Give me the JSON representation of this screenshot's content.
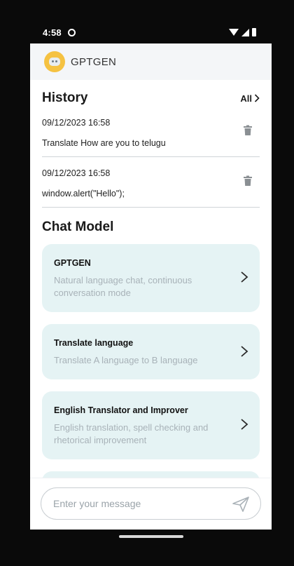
{
  "status_bar": {
    "time": "4:58"
  },
  "app_bar": {
    "title": "GPTGEN"
  },
  "history": {
    "title": "History",
    "all_label": "All",
    "items": [
      {
        "date": "09/12/2023 16:58",
        "text": "Translate How are you to telugu"
      },
      {
        "date": "09/12/2023 16:58",
        "text": "window.alert(\"Hello\");"
      }
    ]
  },
  "chat_model": {
    "title": "Chat Model",
    "models": [
      {
        "name": "GPTGEN",
        "description": "Natural language chat, continuous conversation mode"
      },
      {
        "name": "Translate language",
        "description": "Translate A language to B language"
      },
      {
        "name": "English Translator and Improver",
        "description": "English translation, spell checking and rhetorical improvement"
      }
    ]
  },
  "composer": {
    "placeholder": "Enter your message"
  },
  "colors": {
    "card_background": "#e5f3f4",
    "logo_accent": "#f5c242",
    "muted_text": "#a8b2b8"
  },
  "icons": {
    "send": "send-icon",
    "trash": "trash-icon",
    "chevron": "chevron-right-icon"
  }
}
